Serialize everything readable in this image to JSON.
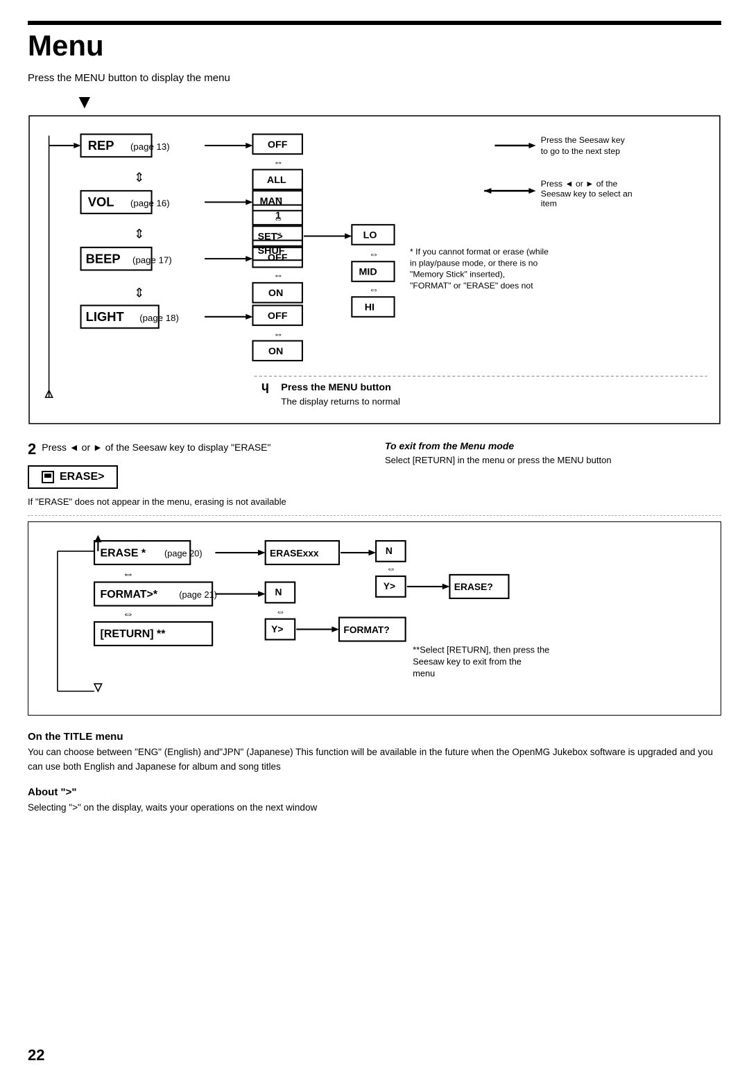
{
  "page": {
    "title": "Menu",
    "number": "22",
    "intro": "Press the MENU button to display the menu"
  },
  "legend": {
    "seesaw_next": "Press the Seesaw key to go to the next step",
    "seesaw_select": "Press ◄ or ► of the Seesaw key to select an item"
  },
  "main_menu_items": [
    {
      "label": "REP",
      "page": "(page 13)"
    },
    {
      "label": "VOL",
      "page": "(page 16)"
    },
    {
      "label": "BEEP",
      "page": "(page 17)"
    },
    {
      "label": "LIGHT",
      "page": "(page 18)"
    }
  ],
  "rep_options": [
    "OFF",
    "ALL",
    "1",
    "SHUF"
  ],
  "vol_options": [
    "MAN",
    "SET>"
  ],
  "set_options": [
    "LO",
    "MID",
    "HI"
  ],
  "beep_options": [
    "OFF",
    "ON"
  ],
  "light_options": [
    "OFF",
    "ON"
  ],
  "step2": {
    "number": "2",
    "text": "Press ◄ or ► of the Seesaw key to display \"ERASE\"",
    "erase_display": "ERASE>",
    "note": "If \"ERASE\" does not appear in the menu, erasing is not available"
  },
  "menu_button_note": {
    "symbol": "ɥ",
    "line1": "Press the MENU button",
    "line2": "The display returns to normal"
  },
  "exit_section": {
    "title": "To exit from the Menu mode",
    "body": "Select [RETURN] in the menu or press the MENU button"
  },
  "lower_menu_items": [
    {
      "label": "ERASE *",
      "page": "(page 20)"
    },
    {
      "label": "FORMAT>*",
      "page": "(page 21)"
    },
    {
      "label": "[RETURN] **",
      "page": ""
    }
  ],
  "erase_flow": {
    "start": "ERASExxx",
    "n": "N",
    "y": "Y>",
    "end": "ERASE?"
  },
  "format_flow": {
    "n": "N",
    "y": "Y>",
    "end": "FORMAT?"
  },
  "footnotes": {
    "asterisk1": "* If you cannot format or erase (while in play/pause mode, or there is no \"Memory Stick\" inserted), \"FORMAT\" or \"ERASE\" does not",
    "asterisk2": "**Select [RETURN], then press the Seesaw key to exit from the menu"
  },
  "title_menu": {
    "title": "On the TITLE menu",
    "body": "You can choose between \"ENG\" (English) and\"JPN\" (Japanese)  This function will be available in the future when the OpenMG Jukebox software is upgraded and you can use both English and Japanese for album and song titles"
  },
  "about": {
    "title": "About \">\"",
    "body": "Selecting \">\" on the display, waits your operations on the next window"
  }
}
